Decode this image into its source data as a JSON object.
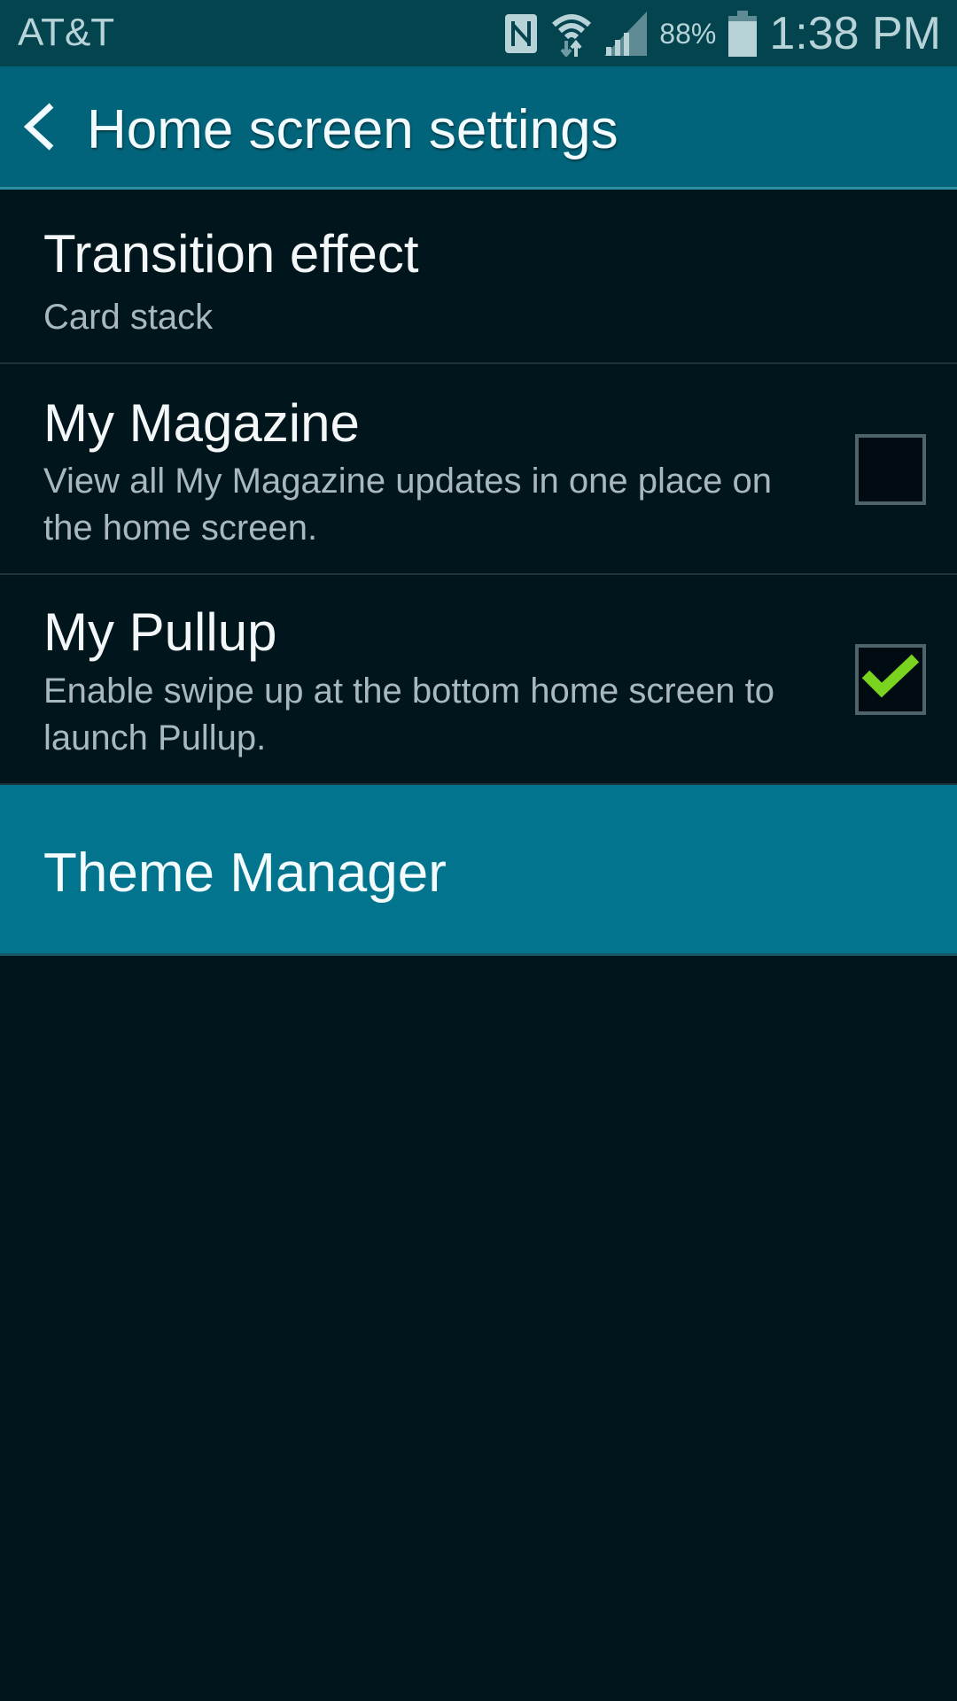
{
  "status_bar": {
    "carrier": "AT&T",
    "icons": [
      "nfc-icon",
      "wifi-icon",
      "signal-icon",
      "battery-icon"
    ],
    "battery_percent": "88%",
    "time": "1:38 PM"
  },
  "app_bar": {
    "back_icon": "chevron-left-icon",
    "title": "Home screen settings"
  },
  "settings": [
    {
      "title": "Transition effect",
      "subtitle": "Card stack"
    },
    {
      "title": "My Magazine",
      "subtitle": "View all My Magazine updates in one place on the home screen.",
      "checked": false
    },
    {
      "title": "My Pullup",
      "subtitle": "Enable swipe up at the bottom home screen to launch Pullup.",
      "checked": true
    },
    {
      "title": "Theme Manager",
      "highlighted": true
    }
  ],
  "colors": {
    "status_bar": "#03444f",
    "app_bar": "#02647a",
    "background": "#01151d",
    "highlight": "#02748e",
    "check": "#7ad41f"
  }
}
